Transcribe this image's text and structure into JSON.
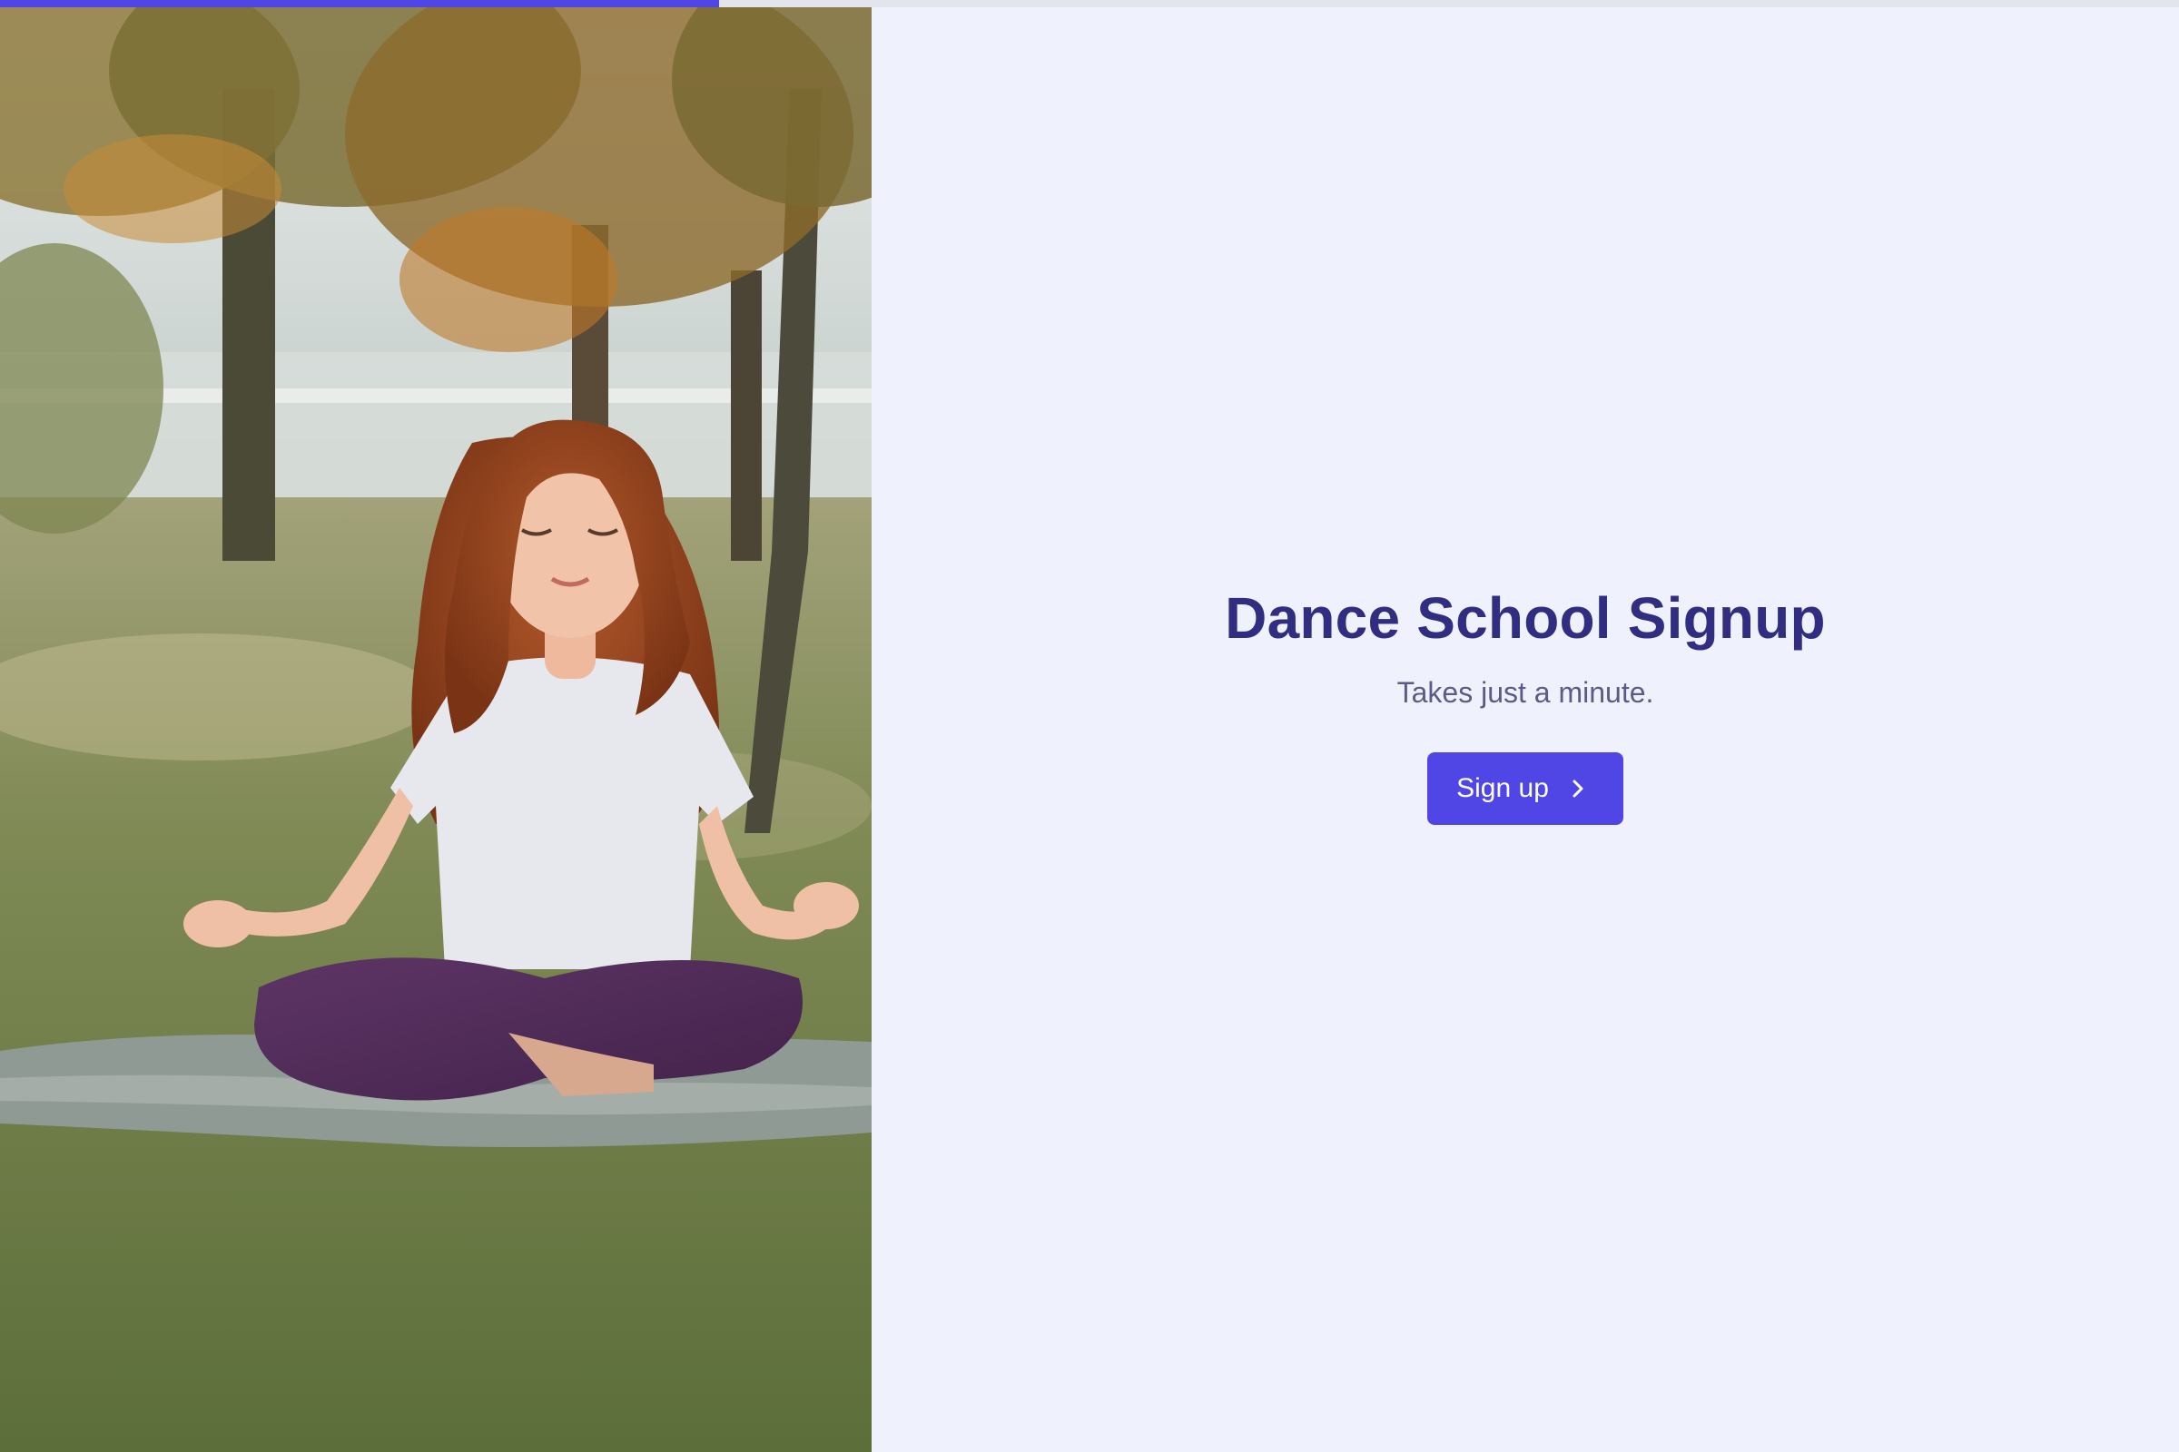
{
  "progress": {
    "fraction": 0.33,
    "color": "#4F46E5"
  },
  "hero_image": {
    "subject": "woman with curly red hair meditating cross-legged on a grey blanket in an autumn park"
  },
  "main": {
    "title": "Dance School Signup",
    "subtitle": "Takes just a minute.",
    "cta_label": "Sign up",
    "cta_icon": "chevron-right-icon"
  },
  "colors": {
    "background": "#EFF2FD",
    "accent": "#4F46E5",
    "title": "#312E81",
    "subtitle": "#5D5A88"
  }
}
